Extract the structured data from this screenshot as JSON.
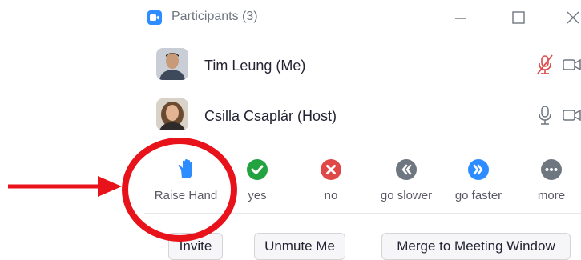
{
  "window": {
    "title": "Participants (3)"
  },
  "participants": [
    {
      "name": "Tim Leung (Me)",
      "mic": "mic-muted-icon",
      "cam": "video-camera-icon"
    },
    {
      "name": "Csilla Csaplár (Host)",
      "mic": "microphone-icon",
      "cam": "video-camera-icon"
    }
  ],
  "reactions": [
    {
      "label": "Raise Hand",
      "icon": "raise-hand-icon"
    },
    {
      "label": "yes",
      "icon": "yes-check-icon"
    },
    {
      "label": "no",
      "icon": "no-x-icon"
    },
    {
      "label": "go slower",
      "icon": "go-slower-icon"
    },
    {
      "label": "go faster",
      "icon": "go-faster-icon"
    },
    {
      "label": "more",
      "icon": "more-icon"
    }
  ],
  "buttons": {
    "invite": "Invite",
    "unmute": "Unmute Me",
    "merge": "Merge to Meeting Window"
  },
  "colors": {
    "accent": "#2d8cff",
    "yes": "#23a240",
    "no": "#e04848",
    "slower": "#6e7680",
    "muted": "#e04848",
    "annotation": "#e8121a"
  }
}
